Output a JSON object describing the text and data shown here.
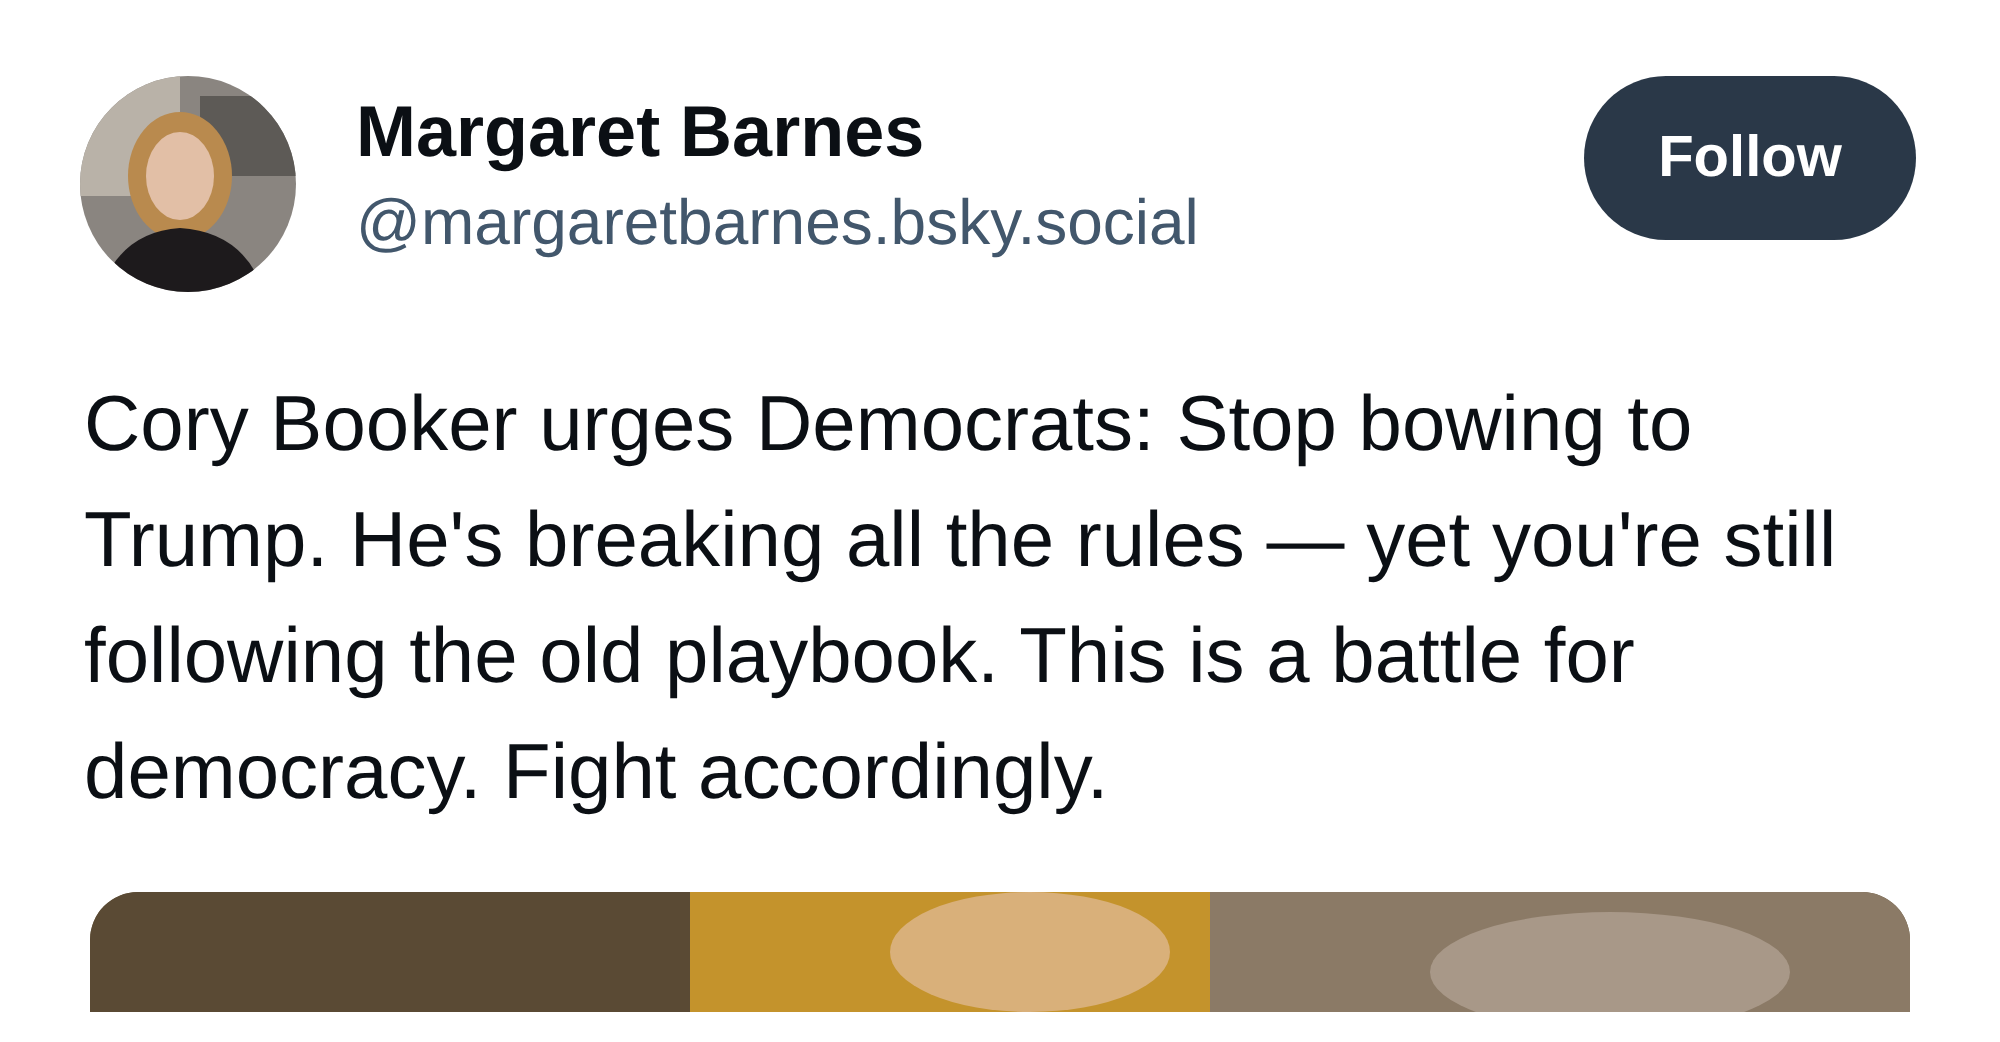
{
  "post": {
    "author": {
      "name": "Margaret Barnes",
      "handle": "@margaretbarnes.bsky.social"
    },
    "follow_button": {
      "label": "Follow"
    },
    "text": "Cory Booker urges Democrats: Stop bowing to Trump. He's breaking all the rules — yet you're still following the old playbook. This is a battle for democracy. Fight accordingly."
  }
}
